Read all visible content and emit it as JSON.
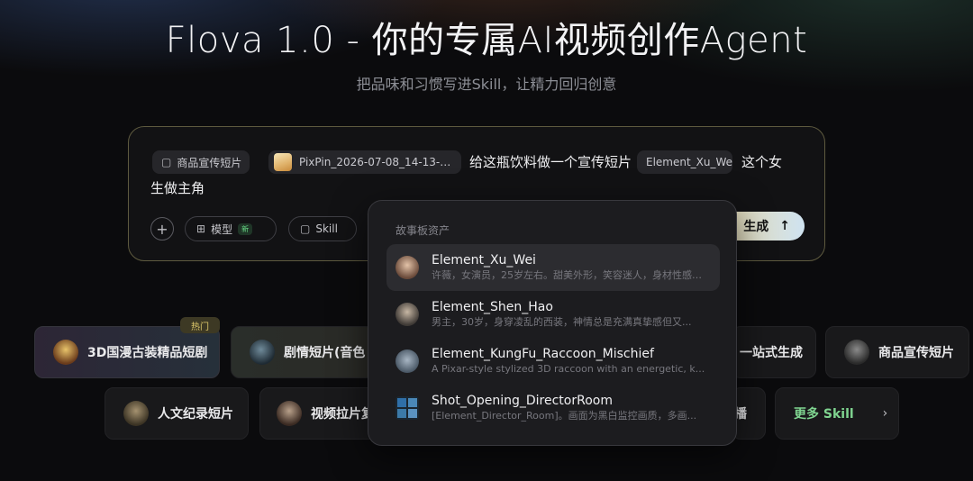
{
  "header": {
    "title": "Flova 1.0 - 你的专属AI视频创作Agent",
    "subtitle": "把品味和习惯写进Skill，让精力回归创意"
  },
  "composer": {
    "skill_chip": "商品宣传短片",
    "file_chip": "PixPin_2026-07-08_14-13-0...",
    "prompt_part1": "给这瓶饮料做一个宣传短片",
    "element_chip": "Element_Xu_Wei",
    "prompt_part2": "这个女",
    "prompt_part3": "生做主角",
    "add_label": "+",
    "model_label": "模型",
    "model_badge": "新",
    "skill_label": "Skill",
    "generate_label": "生成",
    "generate_arrow": "↑"
  },
  "skills": {
    "hot_badge": "热门",
    "card_3d": "3D国漫古装精品短剧",
    "card_drama": "剧情短片(音色",
    "card_onestop": "一站式生成",
    "card_product": "商品宣传短片",
    "card_docu": "人文纪录短片",
    "card_video": "视频拉片复",
    "card_broadcast": "播",
    "card_more": "更多 Skill",
    "card_more_chevron": "›"
  },
  "dropdown": {
    "title": "故事板资产",
    "items": [
      {
        "name": "Element_Xu_Wei",
        "desc": "许薇，女演员，25岁左右。甜美外形，笑容迷人，身材性感，..."
      },
      {
        "name": "Element_Shen_Hao",
        "desc": "男主，30岁，身穿凌乱的西装，神情总是充满真挚感但又..."
      },
      {
        "name": "Element_KungFu_Raccoon_Mischief",
        "desc": "A Pixar-style stylized 3D raccoon with an energetic, k..."
      },
      {
        "name": "Shot_Opening_DirectorRoom",
        "desc": "[Element_Director_Room]。画面为黑白监控画质，多画..."
      }
    ]
  },
  "colors": {
    "background": "#0b0b0d",
    "composer_border": "#5e5a3f",
    "more_skill_text": "#7fd490",
    "new_badge": "#67d985"
  },
  "icons": {
    "skill_chip_icon": "bag-icon",
    "model_icon": "grid-icon",
    "skill_pill_icon": "bag-icon",
    "generate_icon": "arrow-up-icon"
  }
}
